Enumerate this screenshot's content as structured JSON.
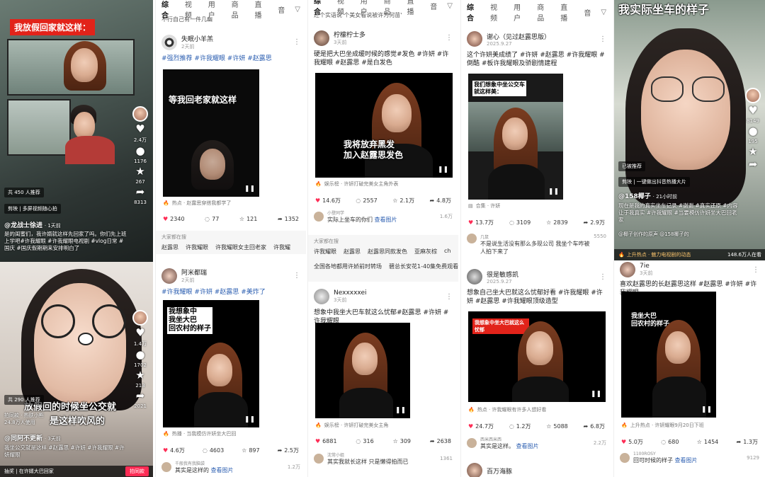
{
  "col1": {
    "top": {
      "title_overlay": "我放假回家就这样：",
      "promoted": "共 450 人推荐",
      "jianying": "剪映 | 多屏视频随心拍",
      "user": "@龙战士徐进",
      "time": "· 1天前",
      "desc": "是的闺蜜们，我许婿就这样先回家了吗。你们先上班上学吧#许我耀眼 #许我耀眼电视剧 #vlog日常 #国庆 #国庆假期期来安排明白了",
      "counts": {
        "likes": "2.4万",
        "comments": "1176",
        "favs": "267",
        "shares": "8313"
      }
    },
    "bottom": {
      "overlay_line1": "放假回的时候坐公交就",
      "overlay_line2": "是这样吹风的",
      "promoted": "共 290 人推荐",
      "sub1": "拍同款 · 热肤小熊",
      "sub2": "24.8万人使用",
      "user": "@同阿不更新",
      "time": "· 3天前",
      "desc": "我坐公交就是这样 #赵露思 #许妍 #许我耀眼 #许妍耀眼",
      "counts": {
        "likes": "1.4万",
        "comments": "1702",
        "favs": "213",
        "shares": "2021"
      },
      "bottom_left": "抽奖 | 在许婿大巴回家",
      "bottom_btn": "拍同款"
    }
  },
  "col2": {
    "tabs": [
      "综合",
      "视频",
      "用户",
      "商品",
      "直播",
      "音"
    ],
    "top_text": "不行自己有一件几幽",
    "card1": {
      "name": "失眠小羊羔",
      "date": "2天前",
      "caption": "#强烈推荐 #许我耀眼 #许妍 #赵露思",
      "overlay": "等我回老家就这样",
      "source": "热点 · 赵露思穿搭我都学了",
      "counts": {
        "likes": "2340",
        "comments": "77",
        "favs": "121",
        "shares": "1352"
      }
    },
    "related": {
      "heading": "大家都在搜",
      "chips": [
        "赵露思",
        "许我耀眼",
        "许我耀眼女主回老家",
        "许我耀"
      ]
    },
    "card2": {
      "name": "阿米都瑞",
      "date": "2天前",
      "caption": "#许我耀眼 #许妍 #赵露思 #美炸了",
      "overlay": "我想象中\n我坐大巴\n回农村的样子",
      "source": "热播 · 当我模仿许妍坐大巴回",
      "counts": {
        "likes": "4.6万",
        "comments": "4603",
        "favs": "897",
        "shares": "2.5万"
      },
      "comment_user": "千般我有我脑袋",
      "comment_text": "其实是这样的",
      "comment_ask": "查看图片",
      "comment_like": "1.2万"
    }
  },
  "col3": {
    "tabs": [
      "综合",
      "视频",
      "用户",
      "商品",
      "直播",
      "音"
    ],
    "top_text": "还个实语说'个美女看说被许为何苗'",
    "card1": {
      "name": "柠檬柠士多",
      "date": "3天前",
      "caption": "硬是把大巴坐成缓时候的感觉#发色 #许妍 #许我耀眼 #赵露思 #是白发色",
      "overlay": "我将放弃黑发\n加入赵露思发色",
      "source": "娱乐榜 · 许妍打破完美女主角外表",
      "counts": {
        "likes": "14.6万",
        "comments": "2557",
        "favs": "2.1万",
        "shares": "4.8万"
      },
      "comment_user": "小登同学",
      "comment_text": "实际上坐车的你们",
      "comment_ask": "查看图片",
      "comment_like": "1.6万"
    },
    "related": {
      "heading": "大家都在搜",
      "chips": [
        "许我耀眼",
        "赵露思",
        "赵露思同款发色",
        "亚麻灰棕",
        "ch"
      ]
    },
    "trend_chips": [
      "全国各地都用许娇前时转场",
      "碧总长安花1-40集免费观看"
    ],
    "card2": {
      "name": "Nexxxxxei",
      "date": "3天前",
      "caption": "想象中我坐大巴车就这么忧郁#赵露思 #许妍 #许我耀眼",
      "source": "娱乐榜 · 许妍打破完美女主角",
      "counts": {
        "likes": "6881",
        "comments": "316",
        "favs": "309",
        "shares": "2638"
      },
      "comment_user": "沈常小姐",
      "comment_text": "其实我就长这样 只是懒得拍而已",
      "comment_like": "1361"
    }
  },
  "col4": {
    "tabs": [
      "综合",
      "视频",
      "用户",
      "商品",
      "直播",
      "音"
    ],
    "card1": {
      "name": "谢心（见过赵露思版）",
      "date": "2025.9.27",
      "caption": "这个许妍美成绩了 #许妍 #赵露思 #许我耀眼 #倒酷 #板许我耀眼及骄剧情建程",
      "overlay": "我们想象中坐公交车\n就这样美：",
      "source": "合集 · 许妍",
      "counts": {
        "likes": "13.7万",
        "comments": "3109",
        "favs": "2839",
        "shares": "2.9万"
      },
      "comment_user": "几鼠",
      "comment_text": "不是说生活没有那么多现公司 我坐个车咋被人拍下来了",
      "comment_like": "5550"
    },
    "card2": {
      "name": "很是敏感凯",
      "date": "2025.9.27",
      "caption": "想象自己坐大巴就这么忧郁好看 #许我耀眼 #许妍 #赵露思 #许我耀眼顶级造型",
      "overlay": "我想象中坐大巴就这么忧郁",
      "source": "热点 · 许我耀眼有许多人想好看",
      "counts": {
        "likes": "24.7万",
        "comments": "1.2万",
        "favs": "5088",
        "shares": "6.8万"
      },
      "comment_user": "西米西米西",
      "comment_text": "其实是这样。",
      "comment_ask": "查看图片",
      "comment_like": "2.2万"
    },
    "card3_name": "百万海豚"
  },
  "col5": {
    "top": {
      "overlay": "我实际坐车的样子",
      "promoted": "已被推荐",
      "jianying": "剪映 | 一键做出抖音热播大片",
      "user": "@158椰子",
      "time": "· 21小时前",
      "desc": "现在是我的真实坐车记录 #谢谢 #真实还原 #内容让于我真实 #许我耀眼 #当要模仿许妍坐大巴回老家",
      "music": "@椰子创作的原声 @158椰子的",
      "hot": "上升热点 · 魅力电视剧的动态",
      "hot_count": "148.6万人在看",
      "counts": {
        "likes": "8149",
        "comments": "195",
        "favs": "",
        "shares": ""
      }
    },
    "card": {
      "name": "7ie",
      "date": "3天前",
      "caption": "喜欢赵露思的长赵露思这样 #赵露思 #许妍 #许我耀眼",
      "overlay": "我坐大巴\n回农村的样子",
      "source": "上升热点 · 许妍耀眼9月20日下班",
      "counts": {
        "likes": "5.0万",
        "comments": "680",
        "favs": "1454",
        "shares": "1.3万"
      },
      "comment_user": "1100ROSY",
      "comment_text": "回可时候的样子",
      "comment_ask": "查看图片",
      "comment_like": "9129"
    }
  }
}
